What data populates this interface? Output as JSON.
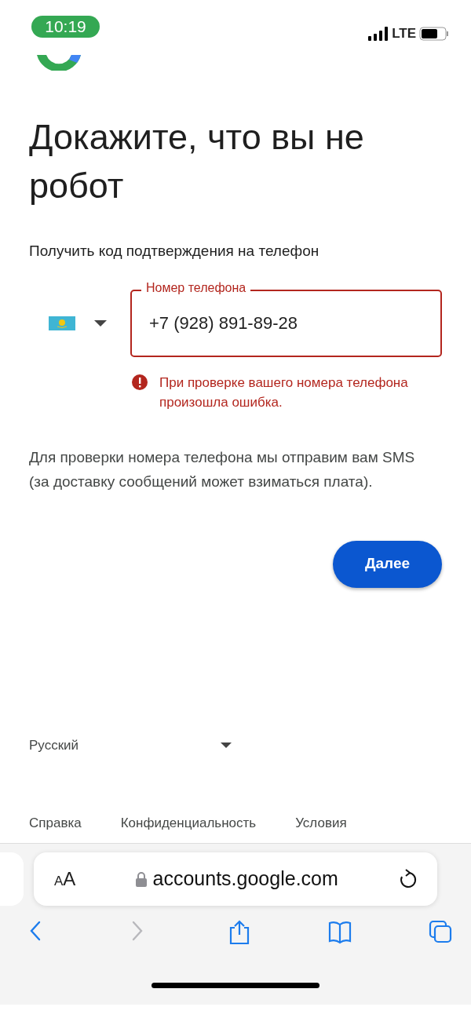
{
  "status_bar": {
    "time": "10:19",
    "network": "LTE"
  },
  "heading": "Докажите, что вы не робот",
  "subtitle": "Получить код подтверждения на телефон",
  "phone_field": {
    "label": "Номер телефона",
    "value": "+7 (928) 891-89-28",
    "error": true
  },
  "error_message": "При проверке вашего номера телефона произошла ошибка.",
  "info": "Для проверки номера телефона мы отправим вам SMS (за доставку сообщений может взиматься плата).",
  "next_button": "Далее",
  "language": "Русский",
  "footer_links": [
    "Справка",
    "Конфиденциальность",
    "Условия"
  ],
  "browser": {
    "reader_button": "AA",
    "url": "accounts.google.com",
    "toolbar": [
      {
        "kind": "back",
        "disabled": false
      },
      {
        "kind": "forward",
        "disabled": true
      },
      {
        "kind": "share",
        "disabled": false
      },
      {
        "kind": "bookmarks",
        "disabled": false
      },
      {
        "kind": "tabs",
        "disabled": false
      }
    ]
  }
}
